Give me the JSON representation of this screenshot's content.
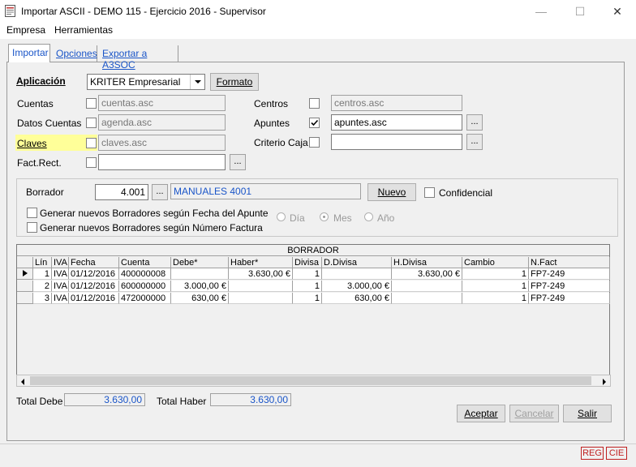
{
  "window": {
    "title": "Importar ASCII - DEMO 115 - Ejercicio 2016 - Supervisor",
    "minimize": "—",
    "maximize": "☐",
    "close": "✕"
  },
  "menu": [
    "Empresa",
    "Herramientas"
  ],
  "tabs": [
    "Importar",
    "Opciones",
    "Exportar a A3SOC"
  ],
  "form": {
    "aplicacion_label": "Aplicación",
    "aplicacion_value": "KRITER Empresarial",
    "formato_label": "Formato",
    "cuentas_label": "Cuentas",
    "cuentas_file": "cuentas.asc",
    "datos_cuentas_label": "Datos Cuentas",
    "datos_cuentas_file": "agenda.asc",
    "claves_label": "Claves",
    "claves_file": "claves.asc",
    "fact_rect_label": "Fact.Rect.",
    "fact_rect_file": "",
    "centros_label": "Centros",
    "centros_file": "centros.asc",
    "apuntes_label": "Apuntes",
    "apuntes_file": "apuntes.asc",
    "criterio_caja_label": "Criterio Caja",
    "criterio_caja_file": "",
    "dots": "..."
  },
  "borrador_group": {
    "borrador_label": "Borrador",
    "borrador_number": "4.001",
    "borrador_desc": "MANUALES 4001",
    "nuevo_label": "Nuevo",
    "confidencial_label": "Confidencial",
    "gen_fecha_label": "Generar nuevos Borradores según Fecha del Apunte",
    "gen_factura_label": "Generar nuevos Borradores según Número Factura",
    "radio_dia": "Día",
    "radio_mes": "Mes",
    "radio_ano": "Año"
  },
  "grid": {
    "title": "BORRADOR",
    "columns": [
      "Lín",
      "IVA",
      "Fecha",
      "Cuenta",
      "Debe*",
      "Haber*",
      "Divisa",
      "D.Divisa",
      "H.Divisa",
      "Cambio",
      "N.Fact"
    ],
    "rows": [
      {
        "lin": "1",
        "iva": "IVA",
        "fecha": "01/12/2016",
        "cuenta": "400000008",
        "debe": "",
        "haber": "3.630,00 €",
        "divisa": "1",
        "ddivisa": "",
        "hdivisa": "3.630,00 €",
        "cambio": "1",
        "nfact": "FP7-249"
      },
      {
        "lin": "2",
        "iva": "IVA",
        "fecha": "01/12/2016",
        "cuenta": "600000000",
        "debe": "3.000,00 €",
        "haber": "",
        "divisa": "1",
        "ddivisa": "3.000,00 €",
        "hdivisa": "",
        "cambio": "1",
        "nfact": "FP7-249"
      },
      {
        "lin": "3",
        "iva": "IVA",
        "fecha": "01/12/2016",
        "cuenta": "472000000",
        "debe": "630,00 €",
        "haber": "",
        "divisa": "1",
        "ddivisa": "630,00 €",
        "hdivisa": "",
        "cambio": "1",
        "nfact": "FP7-249"
      }
    ]
  },
  "totals": {
    "debe_label": "Total Debe",
    "debe_value": "3.630,00",
    "haber_label": "Total Haber",
    "haber_value": "3.630,00"
  },
  "buttons": {
    "aceptar": "Aceptar",
    "cancelar": "Cancelar",
    "salir": "Salir"
  },
  "status": {
    "reg": "REG",
    "cie": "CIE"
  },
  "colors": {
    "highlight": "#ffff99",
    "link_blue": "#1a55c8",
    "status_red": "#c02020"
  }
}
